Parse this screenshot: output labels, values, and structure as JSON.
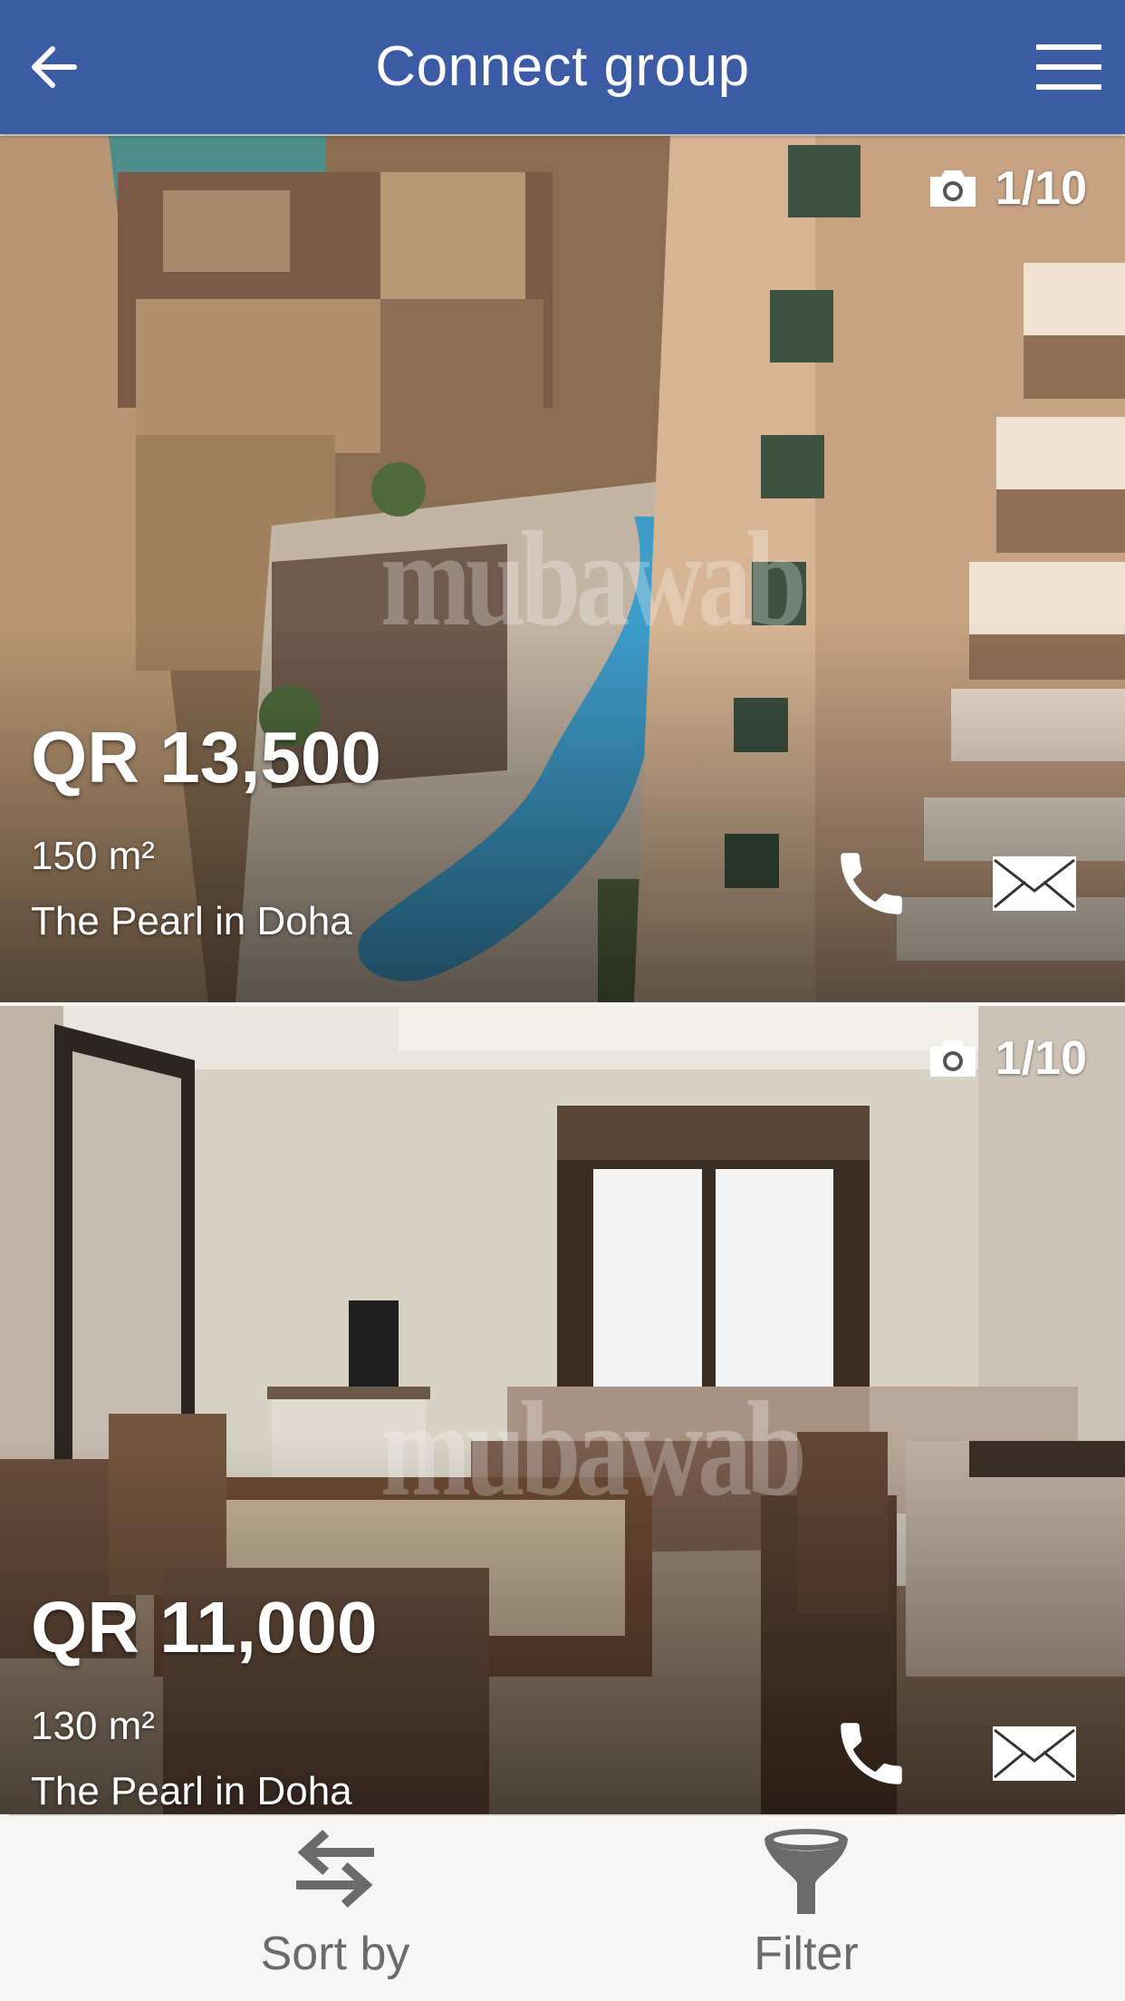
{
  "header": {
    "title": "Connect group",
    "background": "#3b5ba5"
  },
  "listings": [
    {
      "photo_count": "1/10",
      "price": "QR 13,500",
      "area": "150 m²",
      "location": "The Pearl in Doha",
      "watermark": "mubawab"
    },
    {
      "photo_count": "1/10",
      "price": "QR 11,000",
      "area": "130 m²",
      "location": "The Pearl in Doha",
      "watermark": "mubawab"
    }
  ],
  "bottom_bar": {
    "sort_label": "Sort by",
    "filter_label": "Filter"
  },
  "icons": [
    "back-arrow-icon",
    "hamburger-menu-icon",
    "camera-icon",
    "phone-icon",
    "mail-icon",
    "sort-arrows-icon",
    "filter-funnel-icon"
  ]
}
